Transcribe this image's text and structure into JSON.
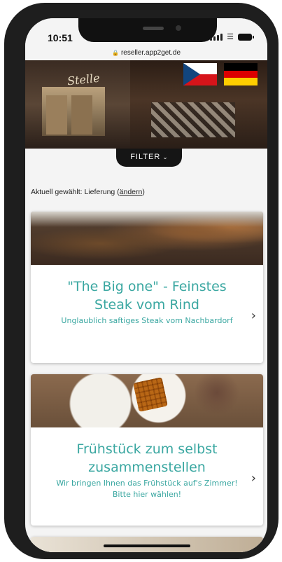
{
  "status_bar": {
    "time": "10:51"
  },
  "browser": {
    "url": "reseller.app2get.de"
  },
  "hero": {
    "logo_text": "Stelle"
  },
  "filter": {
    "label": "FILTER",
    "chevron": "⌄"
  },
  "selection": {
    "prefix": "Aktuell gewählt: Lieferung (",
    "link": "ändern",
    "suffix": ")"
  },
  "products": [
    {
      "title": "\"The Big one\" - Feinstes Steak vom Rind",
      "subtitle": "Unglaublich saftiges Steak vom Nachbardorf"
    },
    {
      "title": "Frühstück zum selbst zusammenstellen",
      "subtitle": "Wir bringen Ihnen das Frühstück auf's Zimmer! Bitte hier wählen!"
    }
  ],
  "icons": {
    "lock": "lock-icon",
    "chevron_right": "chevron-right-icon",
    "flag_cz": "czech-flag-icon",
    "flag_de": "german-flag-icon"
  },
  "colors": {
    "accent": "#3aa7a1",
    "filter_bg": "#151515",
    "frame": "#1e1e1e"
  }
}
